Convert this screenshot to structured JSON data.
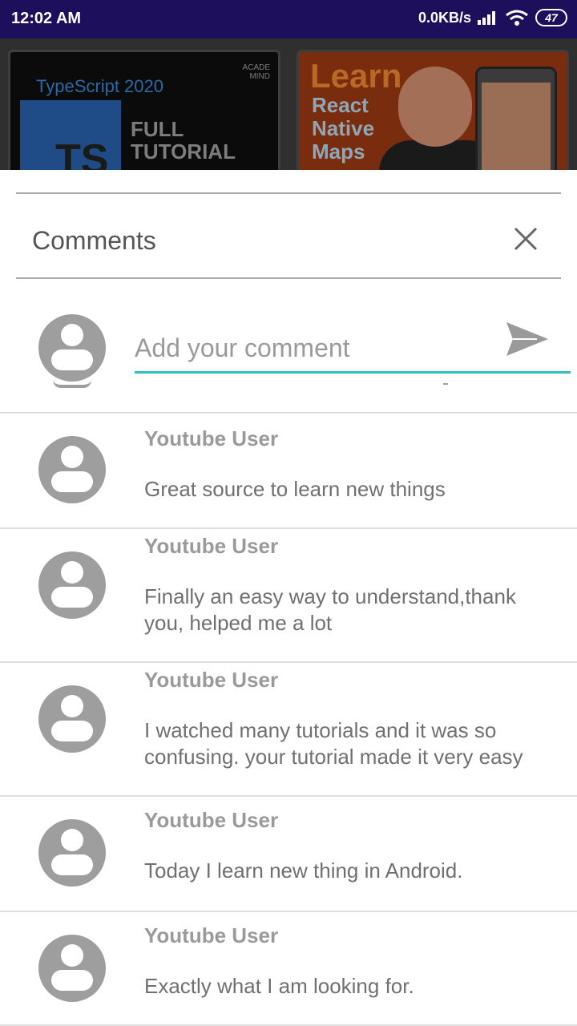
{
  "status": {
    "time": "12:02 AM",
    "net_speed": "0.0KB/s",
    "battery": "47"
  },
  "background": {
    "thumb1": {
      "title": "TypeScript 2020",
      "badge": "TS",
      "overlay_line1": "FULL",
      "overlay_line2": "TUTORIAL",
      "logo_line1": "ACADE",
      "logo_line2": "MIND"
    },
    "thumb2": {
      "headline": "Learn",
      "line1": "React",
      "line2": "Native",
      "line3": "Maps"
    }
  },
  "sheet": {
    "title": "Comments",
    "input_placeholder": "Add your comment"
  },
  "comments": [
    {
      "user": "Youtube User",
      "text": "Great source to learn new things"
    },
    {
      "user": "Youtube User",
      "text": "Finally an easy way to understand,thank you, helped me a lot"
    },
    {
      "user": "Youtube User",
      "text": "I watched many tutorials and it was so confusing. your tutorial made it very easy"
    },
    {
      "user": "Youtube User",
      "text": "Today I learn new thing in Android."
    },
    {
      "user": "Youtube User",
      "text": "Exactly what I am looking for."
    }
  ],
  "colors": {
    "accent": "#2cc1bd",
    "status_bar": "#1e0f5c",
    "avatar": "#9e9e9e"
  }
}
